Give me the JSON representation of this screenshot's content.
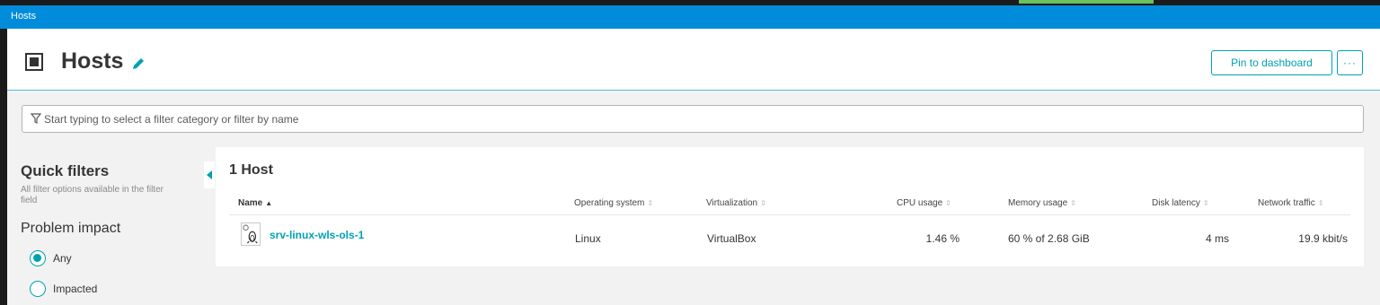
{
  "breadcrumb": {
    "label": "Hosts"
  },
  "header": {
    "title": "Hosts",
    "pin_label": "Pin to dashboard",
    "more_label": "···"
  },
  "filter": {
    "placeholder": "Start typing to select a filter category or filter by name"
  },
  "quick_filters": {
    "title": "Quick filters",
    "help": "All filter options available in the filter field",
    "problem_impact": {
      "title": "Problem impact",
      "options": [
        {
          "label": "Any",
          "checked": true
        },
        {
          "label": "Impacted",
          "checked": false
        }
      ]
    }
  },
  "hosts": {
    "count_label": "1 Host",
    "columns": [
      "Name",
      "Operating system",
      "Virtualization",
      "CPU usage",
      "Memory usage",
      "Disk latency",
      "Network traffic"
    ],
    "rows": [
      {
        "name": "srv-linux-wls-ols-1",
        "os": "Linux",
        "virtualization": "VirtualBox",
        "cpu": "1.46 %",
        "memory": "60 % of 2.68 GiB",
        "disk_latency": "4 ms",
        "network": "19.9 kbit/s"
      }
    ]
  },
  "icons": {
    "host": "host-icon",
    "edit": "pencil-icon",
    "filter": "funnel-icon",
    "os": "linux-icon",
    "collapse": "collapse-left-icon"
  },
  "colors": {
    "breadcrumb_bar": "#008cdb",
    "accent": "#00a1b2",
    "top_accent": "#6bc15c"
  }
}
